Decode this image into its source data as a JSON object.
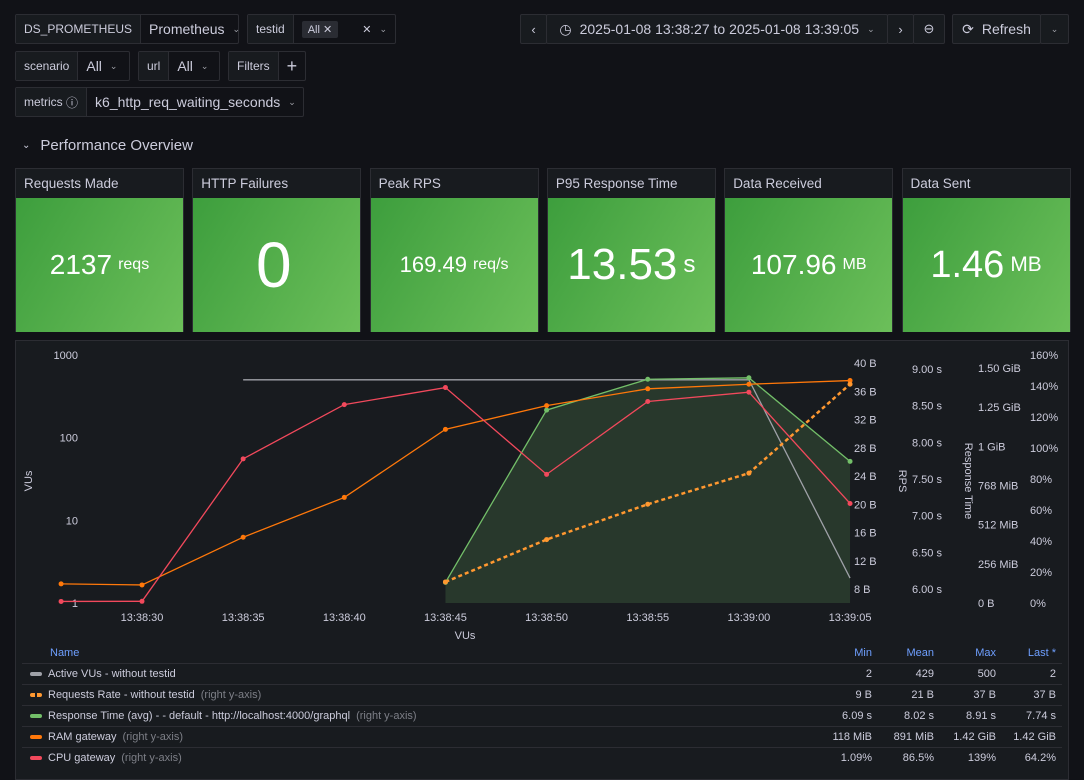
{
  "vars": {
    "ds": {
      "label": "DS_PROMETHEUS",
      "value": "Prometheus"
    },
    "testid": {
      "label": "testid",
      "tag": "All"
    },
    "scenario": {
      "label": "scenario",
      "value": "All"
    },
    "url": {
      "label": "url",
      "value": "All"
    },
    "filters": {
      "label": "Filters",
      "add": "+"
    },
    "metrics": {
      "label": "metrics",
      "value": "k6_http_req_waiting_seconds"
    }
  },
  "toolbar": {
    "time_range": "2025-01-08 13:38:27 to 2025-01-08 13:39:05",
    "refresh": "Refresh"
  },
  "section": {
    "title": "Performance Overview"
  },
  "stats": [
    {
      "title": "Requests Made",
      "value": "2137",
      "unit": "reqs"
    },
    {
      "title": "HTTP Failures",
      "value": "0",
      "unit": ""
    },
    {
      "title": "Peak RPS",
      "value": "169.49",
      "unit": "req/s"
    },
    {
      "title": "P95 Response Time",
      "value": "13.53",
      "unit": "s"
    },
    {
      "title": "Data Received",
      "value": "107.96",
      "unit": "MB"
    },
    {
      "title": "Data Sent",
      "value": "1.46",
      "unit": "MB"
    }
  ],
  "chart_data": {
    "type": "line",
    "xlabel": "VUs",
    "x_ticks": [
      "13:38:30",
      "13:38:35",
      "13:38:40",
      "13:38:45",
      "13:38:50",
      "13:38:55",
      "13:39:00",
      "13:39:05"
    ],
    "left_axis": {
      "label": "VUs",
      "scale": "log",
      "ticks": [
        "1",
        "10",
        "100",
        "1000"
      ]
    },
    "axis_bytes": {
      "ticks": [
        "8 B",
        "12 B",
        "16 B",
        "20 B",
        "24 B",
        "28 B",
        "32 B",
        "36 B",
        "40 B"
      ],
      "label": "RPS"
    },
    "axis_seconds": {
      "ticks": [
        "6.00 s",
        "6.50 s",
        "7.00 s",
        "7.50 s",
        "8.00 s",
        "8.50 s",
        "9.00 s"
      ],
      "label": "Response Time"
    },
    "axis_mem": {
      "ticks": [
        "0 B",
        "256 MiB",
        "512 MiB",
        "768 MiB",
        "1 GiB",
        "1.25 GiB",
        "1.50 GiB"
      ]
    },
    "axis_pct": {
      "ticks": [
        "0%",
        "20%",
        "40%",
        "60%",
        "80%",
        "100%",
        "120%",
        "140%",
        "160%"
      ]
    },
    "series": [
      {
        "name": "Active VUs - without testid",
        "color": "#9fa1a8",
        "time": [
          "13:38:35",
          "13:39:00",
          "13:39:05"
        ],
        "values": [
          500,
          500,
          2
        ]
      },
      {
        "name": "Requests Rate - without testid",
        "color": "#ff9830",
        "dashed": true,
        "time": [
          "13:38:45",
          "13:38:50",
          "13:38:55",
          "13:39:00",
          "13:39:05"
        ],
        "values_B": [
          9,
          15,
          20,
          24.4,
          37
        ]
      },
      {
        "name": "Response Time (avg) - - default - http://localhost:4000/graphql",
        "color": "#73bf69",
        "fill": true,
        "time": [
          "13:38:45",
          "13:38:50",
          "13:38:55",
          "13:39:00",
          "13:39:05"
        ],
        "values_s": [
          6.09,
          8.44,
          8.86,
          8.88,
          7.74
        ]
      },
      {
        "name": "RAM gateway",
        "color": "#ff780a",
        "time": [
          "13:38:26",
          "13:38:30",
          "13:38:35",
          "13:38:40",
          "13:38:45",
          "13:38:50",
          "13:38:55",
          "13:39:00",
          "13:39:05"
        ],
        "values_MiB": [
          125,
          118,
          430,
          690,
          1135,
          1290,
          1400,
          1430,
          1454
        ]
      },
      {
        "name": "CPU gateway",
        "color": "#f2495c",
        "time": [
          "13:38:26",
          "13:38:30",
          "13:38:35",
          "13:38:40",
          "13:38:45",
          "13:38:50",
          "13:38:55",
          "13:39:00",
          "13:39:05"
        ],
        "values_pct": [
          1,
          1.09,
          93,
          128,
          139,
          83,
          130,
          136,
          64.2
        ]
      }
    ]
  },
  "legend": {
    "headers": [
      "Name",
      "Min",
      "Mean",
      "Max",
      "Last *"
    ],
    "suffix": "(right y-axis)",
    "rows": [
      {
        "name": "Active VUs - without testid",
        "right": false,
        "color": "#9fa1a8",
        "min": "2",
        "mean": "429",
        "max": "500",
        "last": "2"
      },
      {
        "name": "Requests Rate - without testid",
        "right": true,
        "color": "#ff9830",
        "min": "9 B",
        "mean": "21 B",
        "max": "37 B",
        "last": "37 B"
      },
      {
        "name": "Response Time (avg) - - default - http://localhost:4000/graphql",
        "right": true,
        "color": "#73bf69",
        "min": "6.09 s",
        "mean": "8.02 s",
        "max": "8.91 s",
        "last": "7.74 s"
      },
      {
        "name": "RAM gateway",
        "right": true,
        "color": "#ff780a",
        "min": "118 MiB",
        "mean": "891 MiB",
        "max": "1.42 GiB",
        "last": "1.42 GiB"
      },
      {
        "name": "CPU gateway",
        "right": true,
        "color": "#f2495c",
        "min": "1.09%",
        "mean": "86.5%",
        "max": "139%",
        "last": "64.2%"
      }
    ]
  }
}
